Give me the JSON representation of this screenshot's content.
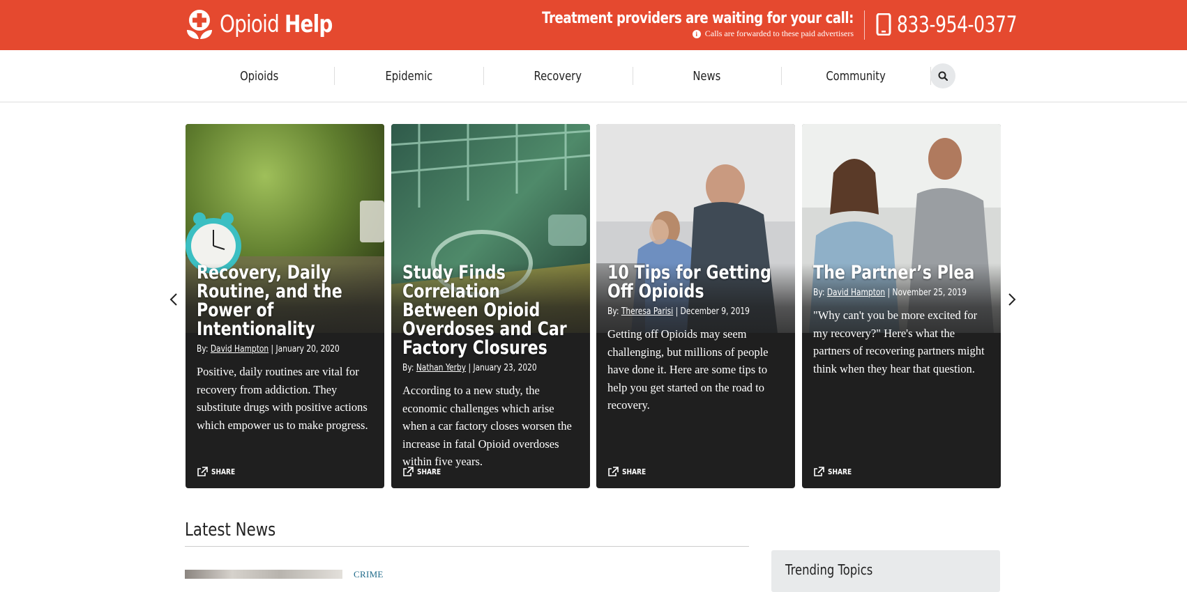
{
  "brand": {
    "name_light": "Opioid",
    "name_bold": "Help",
    "color": "#e5492f"
  },
  "callout": {
    "title": "Treatment providers are waiting for your call:",
    "subtitle": "Calls are forwarded to these paid advertisers",
    "phone": "833-954-0377"
  },
  "nav": {
    "items": [
      {
        "label": "Opioids"
      },
      {
        "label": "Epidemic"
      },
      {
        "label": "Recovery"
      },
      {
        "label": "News"
      },
      {
        "label": "Community"
      }
    ],
    "search_icon": "search-icon"
  },
  "carousel": {
    "cards": [
      {
        "title": "Recovery, Daily Routine, and the Power of Intentionality",
        "by": "By:",
        "author": "David Hampton",
        "date": "| January 20, 2020",
        "excerpt": "Positive, daily routines are vital for recovery from addiction. They substitute drugs with positive actions which empower us to make progress.",
        "share": "SHARE"
      },
      {
        "title": "Study Finds Correlation Between Opioid Overdoses and Car Factory Closures",
        "by": "By:",
        "author": "Nathan Yerby",
        "date": "| January 23, 2020",
        "excerpt": "According to a new study, the economic challenges which arise when a car factory closes worsen the increase in fatal Opioid overdoses within five years.",
        "share": "SHARE"
      },
      {
        "title": "10 Tips for Getting Off Opioids",
        "by": "By:",
        "author": "Theresa Parisi",
        "date": "| December 9, 2019",
        "excerpt": "Getting off Opioids may seem challenging, but millions of people have done it. Here are some tips to help you get started on the road to recovery.",
        "share": "SHARE"
      },
      {
        "title": "The Partner’s Plea",
        "by": "By:",
        "author": "David Hampton",
        "date": "| November 25, 2019",
        "excerpt": "\"Why can't you be more excited for my recovery?\" Here's what the partners of recovering partners might think when they hear that question.",
        "share": "SHARE"
      }
    ]
  },
  "latest": {
    "title": "Latest News",
    "first_category": "CRIME"
  },
  "sidebar": {
    "trending_title": "Trending Topics"
  }
}
